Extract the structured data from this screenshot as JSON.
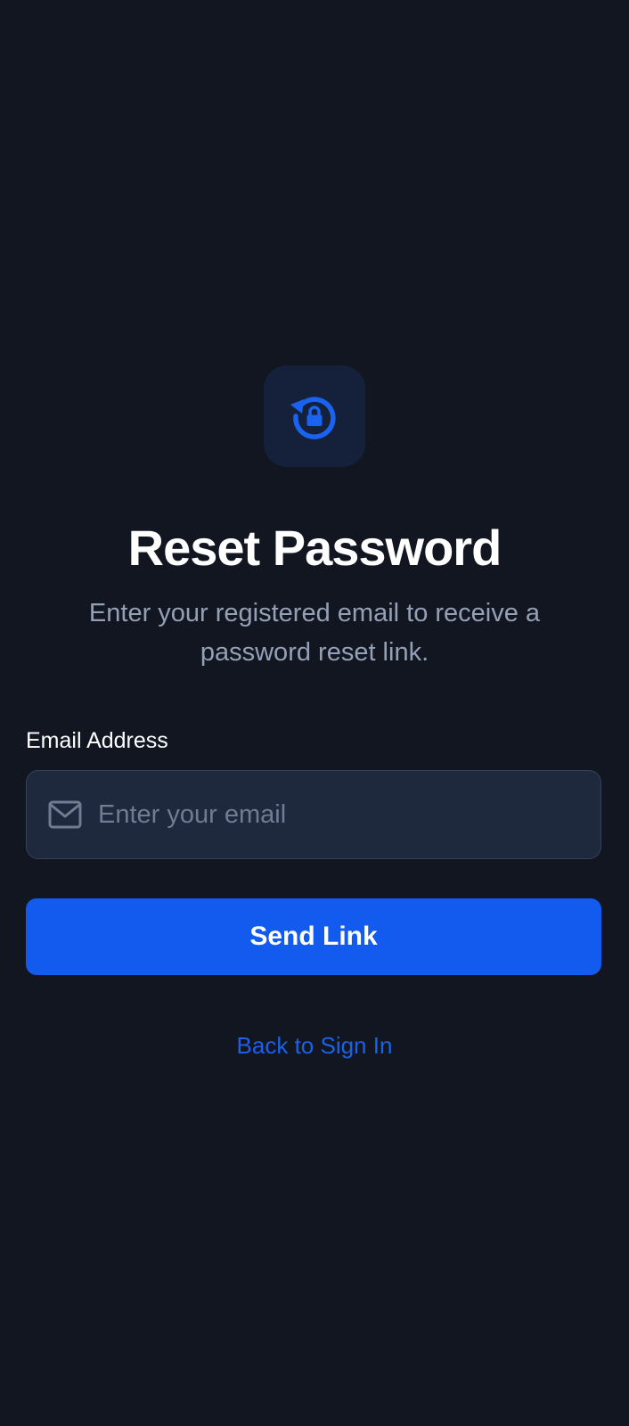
{
  "header": {
    "icon": "lock-reset-icon",
    "title": "Reset Password",
    "subtitle": "Enter your registered email to receive a password reset link."
  },
  "form": {
    "email_label": "Email Address",
    "email_icon": "mail-icon",
    "email_value": "",
    "email_placeholder": "Enter your email",
    "submit_label": "Send Link"
  },
  "footer": {
    "back_link_label": "Back to Sign In"
  },
  "colors": {
    "background": "#111621",
    "accent": "#135bef",
    "icon_tile": "#15203a",
    "input_background": "#1e293d",
    "subtitle_text": "#94a0b6",
    "link": "#1b61e8"
  }
}
